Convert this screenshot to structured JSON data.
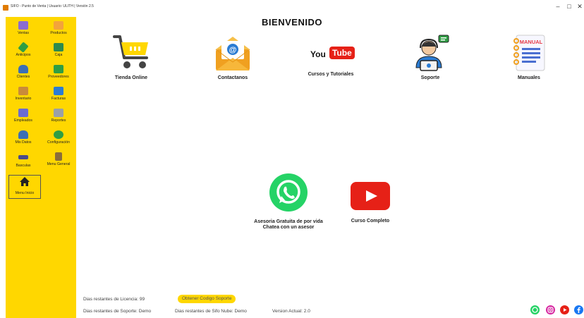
{
  "window": {
    "title": "SIFO - Punto de Venta  |  Usuario: ULITH  |  Versión 2.5",
    "controls": [
      "–",
      "□",
      "✕"
    ]
  },
  "sidebar": {
    "items": [
      {
        "label": "Ventas",
        "icon": "sales-icon",
        "color": "#8b6bd1"
      },
      {
        "label": "Productos",
        "icon": "box-icon",
        "color": "#f3a43b"
      },
      {
        "label": "Anticipos",
        "icon": "pencil-icon",
        "color": "#2f9e44"
      },
      {
        "label": "Caja",
        "icon": "cash-register-icon",
        "color": "#2d8a4e"
      },
      {
        "label": "Clientes",
        "icon": "client-icon",
        "color": "#3b6fb6"
      },
      {
        "label": "Proveedores",
        "icon": "truck-icon",
        "color": "#2f9e44"
      },
      {
        "label": "Inventario",
        "icon": "boxes-icon",
        "color": "#c98b3a"
      },
      {
        "label": "Facturas",
        "icon": "invoice-icon",
        "color": "#2b7cd3"
      },
      {
        "label": "Empleados",
        "icon": "employees-icon",
        "color": "#6b6bd1"
      },
      {
        "label": "Reportes",
        "icon": "report-icon",
        "color": "#9aa0a6"
      },
      {
        "label": "Mis Datos",
        "icon": "user-icon",
        "color": "#3b6fb6"
      },
      {
        "label": "Configuración",
        "icon": "gear-icon",
        "color": "#2f9e44"
      },
      {
        "label": "Basculas",
        "icon": "scale-icon",
        "color": "#4a4a8a"
      },
      {
        "label": "Menu General",
        "icon": "clipboard-icon",
        "color": "#8a6d3b"
      },
      {
        "label": "Menu Inicio",
        "icon": "home-icon",
        "color": "#222222"
      }
    ]
  },
  "main": {
    "title": "BIENVENIDO",
    "tiles": [
      {
        "label": "Tienda Online",
        "icon": "shopping-cart-icon"
      },
      {
        "label": "Contactanos",
        "icon": "email-icon"
      },
      {
        "label": "Cursos y Tutoriales",
        "icon": "youtube-logo-icon",
        "logo_you": "You",
        "logo_tube": "Tube"
      },
      {
        "label": "Soporte",
        "icon": "support-agent-icon"
      },
      {
        "label": "Manuales",
        "icon": "manual-icon",
        "logo_text": "MANUAL"
      }
    ],
    "whatsapp": {
      "label_line1": "Asesoria Gratuita de por vida",
      "label_line2": "Chatea con un asesor",
      "icon": "whatsapp-icon"
    },
    "curso": {
      "label": "Curso Completo",
      "icon": "play-video-icon"
    }
  },
  "footer": {
    "licencia": "Dias restantes de Licencia:  99",
    "button": "Obtener Codigo Soporte",
    "soporte": "Dias restantes de Soporte:  Demo",
    "nube": "Dias restantes de Sifo Nube:  Demo",
    "version": "Version Actual:  2.0",
    "social": [
      {
        "icon": "whatsapp-icon",
        "color": "#25d366"
      },
      {
        "icon": "instagram-icon",
        "color": "#d6249f"
      },
      {
        "icon": "youtube-icon",
        "color": "#e62117"
      },
      {
        "icon": "facebook-icon",
        "color": "#1877f2"
      }
    ]
  },
  "colors": {
    "sidebar": "#ffd700",
    "accent": "#ffd700"
  }
}
